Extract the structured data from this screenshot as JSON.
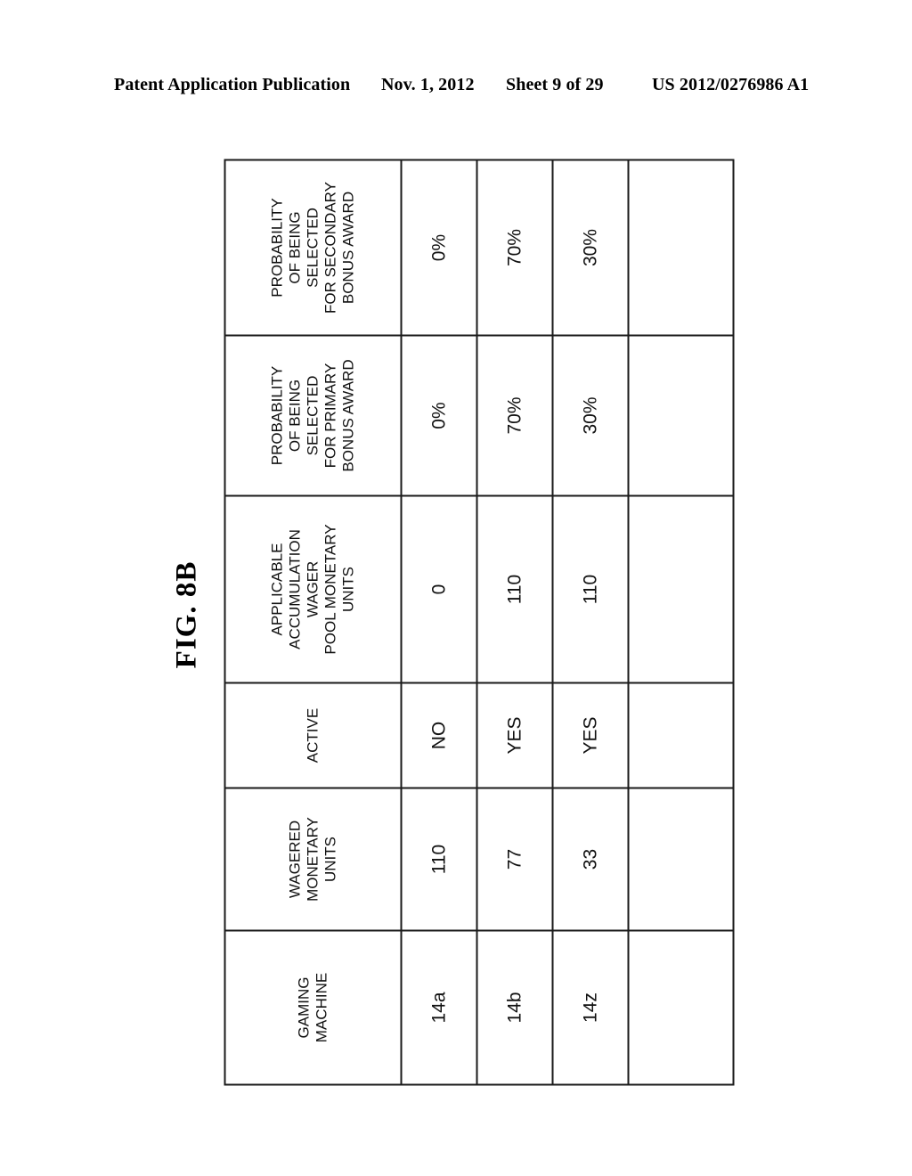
{
  "header": {
    "publication": "Patent Application Publication",
    "date": "Nov. 1, 2012",
    "sheet": "Sheet 9 of 29",
    "number": "US 2012/0276986 A1"
  },
  "figure": {
    "label": "FIG. 8B"
  },
  "table": {
    "columns": [
      {
        "id": "gaming-machine",
        "header_lines": [
          "GAMING",
          "MACHINE"
        ],
        "values": [
          "14a",
          "14b",
          "14z"
        ]
      },
      {
        "id": "wagered-monetary-units",
        "header_lines": [
          "WAGERED",
          "MONETARY",
          "UNITS"
        ],
        "values": [
          "110",
          "77",
          "33"
        ]
      },
      {
        "id": "active",
        "header_lines": [
          "ACTIVE"
        ],
        "values": [
          "NO",
          "YES",
          "YES"
        ]
      },
      {
        "id": "applicable-accumulation-wager-pool-monetary-units",
        "header_lines": [
          "APPLICABLE",
          "ACCUMULATION",
          "WAGER",
          "POOL MONETARY",
          "UNITS"
        ],
        "values": [
          "0",
          "110",
          "110"
        ]
      },
      {
        "id": "probability-primary-bonus-award",
        "header_lines": [
          "PROBABILITY",
          "OF BEING",
          "SELECTED",
          "FOR PRIMARY",
          "BONUS AWARD"
        ],
        "values": [
          "0%",
          "70%",
          "30%"
        ]
      },
      {
        "id": "probability-secondary-bonus-award",
        "header_lines": [
          "PROBABILITY",
          "OF BEING",
          "SELECTED",
          "FOR SECONDARY",
          "BONUS AWARD"
        ],
        "values": [
          "0%",
          "70%",
          "30%"
        ]
      }
    ]
  },
  "colors": {
    "ink": "#111111",
    "rule": "#1a1a1a",
    "page": "#ffffff"
  }
}
